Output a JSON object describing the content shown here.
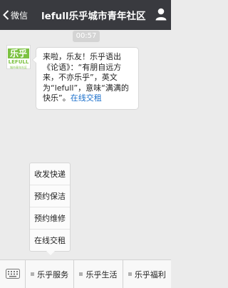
{
  "header": {
    "back_label": "微信",
    "title": "lefull乐乎城市青年社区"
  },
  "chat": {
    "timestamp": "00:57",
    "avatar": {
      "cn": "乐乎",
      "en": "LEFULL",
      "sub": "城市青年社区"
    },
    "message": {
      "text": "来啦，乐友！乐乎语出《论语》：“有朋自远方来，不亦乐乎”，英文为“lefull”，意味“满满的快乐”。",
      "link": "在线交租"
    }
  },
  "popup_menu": {
    "items": [
      "收发快递",
      "预约保洁",
      "预约维修",
      "在线交租"
    ]
  },
  "menubar": {
    "tabs": [
      "乐乎服务",
      "乐乎生活",
      "乐乎福利"
    ]
  },
  "colors": {
    "header_bg": "#393a3f",
    "brand_green": "#7cc242",
    "link_blue": "#1a6fcb"
  }
}
